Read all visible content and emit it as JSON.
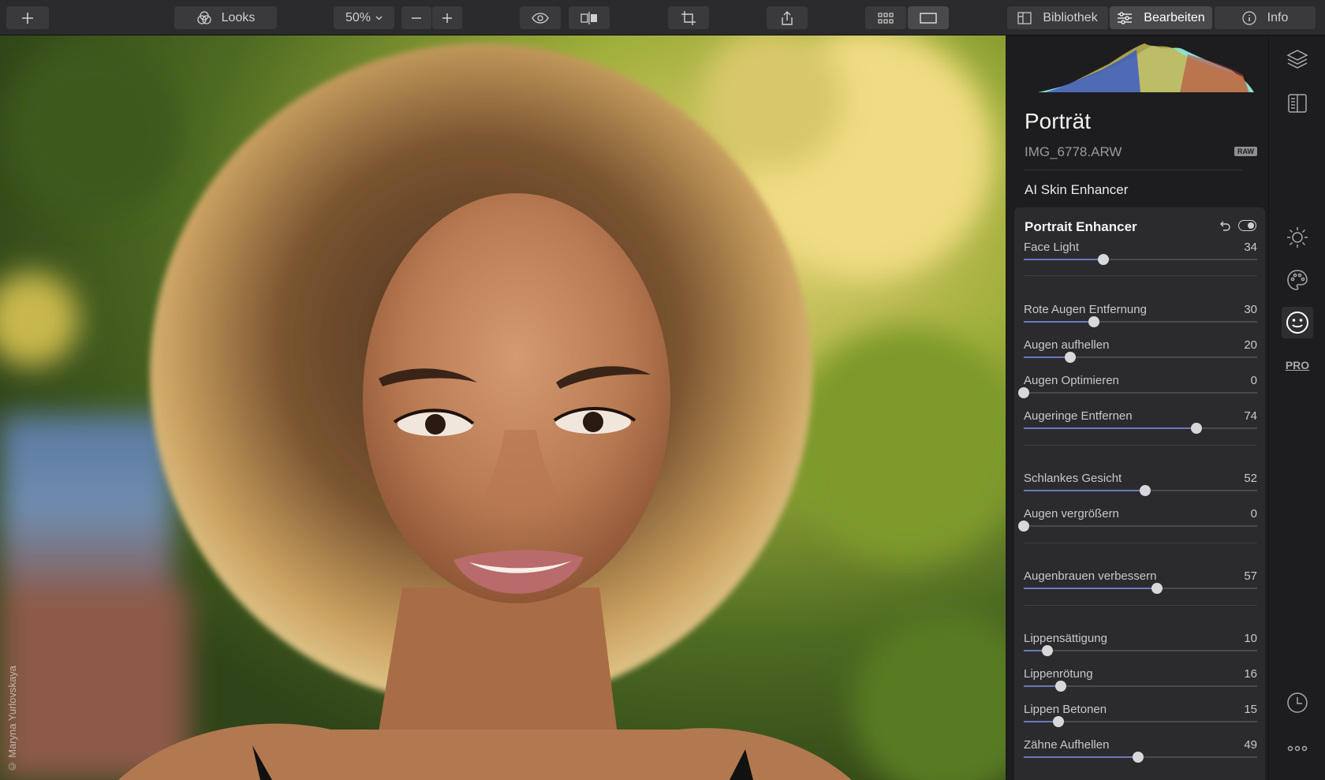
{
  "toolbar": {
    "looks_label": "Looks",
    "zoom_value": "50%",
    "tabs": [
      {
        "label": "Bibliothek",
        "icon": "library-icon"
      },
      {
        "label": "Bearbeiten",
        "icon": "sliders-icon"
      },
      {
        "label": "Info",
        "icon": "info-icon"
      }
    ]
  },
  "photo": {
    "credit": "© Maryna Yurlovskaya"
  },
  "panel": {
    "title": "Porträt",
    "filename": "IMG_6778.ARW",
    "raw_badge": "RAW",
    "section_label": "AI Skin Enhancer",
    "card_title": "Portrait Enhancer",
    "sliders": [
      {
        "label": "Face Light",
        "value": "34",
        "level": 0.34
      },
      {
        "label": "Rote Augen Entfernung",
        "value": "30",
        "level": 0.3
      },
      {
        "label": "Augen aufhellen",
        "value": "20",
        "level": 0.2
      },
      {
        "label": "Augen Optimieren",
        "value": "0",
        "level": 0
      },
      {
        "label": "Augeringe Entfernen",
        "value": "74",
        "level": 0.74
      },
      {
        "label": "Schlankes Gesicht",
        "value": "52",
        "level": 0.52
      },
      {
        "label": "Augen vergrößern",
        "value": "0",
        "level": 0
      },
      {
        "label": "Augenbrauen verbessern",
        "value": "57",
        "level": 0.57
      },
      {
        "label": "Lippensättigung",
        "value": "10",
        "level": 0.1
      },
      {
        "label": "Lippenrötung",
        "value": "16",
        "level": 0.16
      },
      {
        "label": "Lippen Betonen",
        "value": "15",
        "level": 0.15
      },
      {
        "label": "Zähne Aufhellen",
        "value": "49",
        "level": 0.49
      }
    ]
  },
  "rail": {
    "icons": [
      "layers-icon",
      "compare-panel-icon",
      "sun-icon",
      "palette-icon",
      "face-icon",
      "pro-icon",
      "history-icon",
      "more-icon"
    ],
    "pro_label": "PRO"
  },
  "colors": {
    "accent": "#6a7ab8",
    "panel_bg": "#1d1d1f",
    "card_bg": "#2b2b2e",
    "toolbar_bg": "#2b2b2d"
  }
}
